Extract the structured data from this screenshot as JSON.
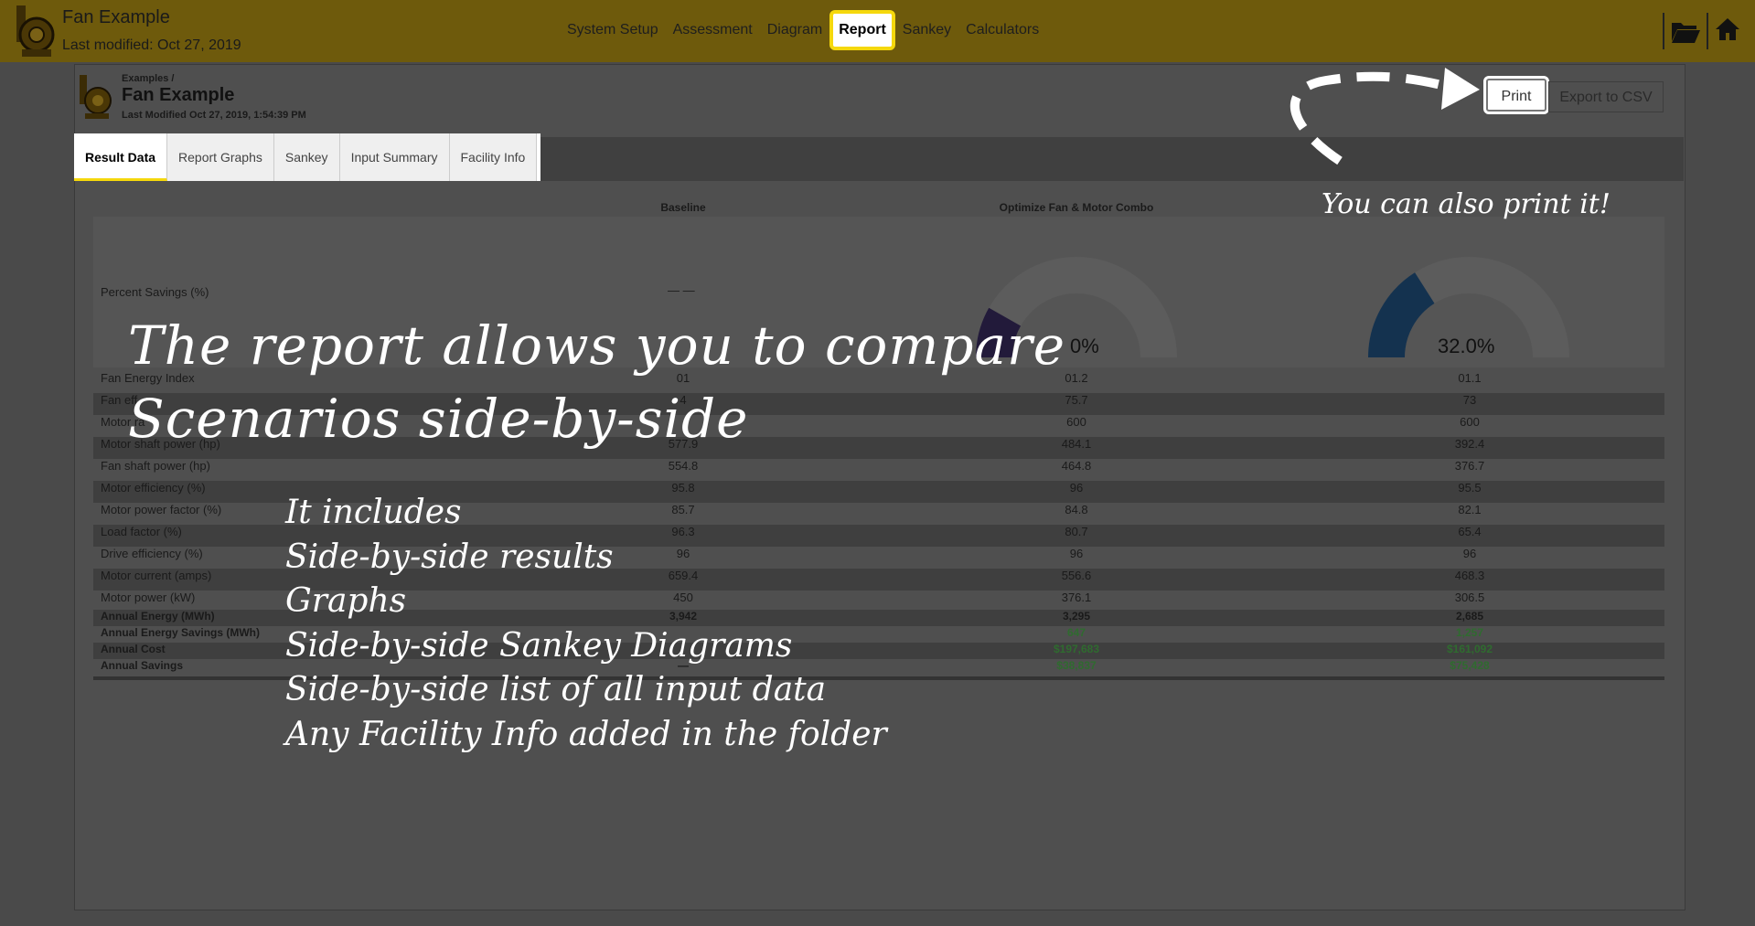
{
  "app": {
    "title": "Fan Example",
    "last_modified": "Last modified: Oct 27, 2019"
  },
  "nav": {
    "items": [
      "System Setup",
      "Assessment",
      "Diagram",
      "Report",
      "Sankey",
      "Calculators"
    ],
    "active": "Report"
  },
  "report_header": {
    "breadcrumb": "Examples /",
    "title": "Fan Example",
    "last_modified": "Last Modified Oct 27, 2019, 1:54:39 PM"
  },
  "buttons": {
    "print": "Print",
    "export_csv": "Export to CSV"
  },
  "tabs": [
    "Result Data",
    "Report Graphs",
    "Sankey",
    "Input Summary",
    "Facility Info"
  ],
  "table": {
    "columns": [
      "Baseline",
      "Optimize Fan & Motor Combo"
    ],
    "percent_savings": {
      "label": "Percent Savings (%)",
      "baseline": "— —",
      "scenario1_visible": "0%",
      "scenario1_fraction": 0.164,
      "scenario2": "32.0%",
      "scenario2_fraction": 0.32
    },
    "rows": [
      {
        "label": "Fan Energy Index",
        "c1": "01",
        "c2": "01.2",
        "c3": "01.1"
      },
      {
        "label": "Fan eff",
        "c1": "4",
        "c2": "75.7",
        "c3": "73"
      },
      {
        "label": "Motor ra",
        "c1": "",
        "c2": "600",
        "c3": "600"
      },
      {
        "label": "Motor shaft power (hp)",
        "c1": "577.9",
        "c2": "484.1",
        "c3": "392.4"
      },
      {
        "label": "Fan shaft power (hp)",
        "c1": "554.8",
        "c2": "464.8",
        "c3": "376.7"
      },
      {
        "label": "Motor efficiency (%)",
        "c1": "95.8",
        "c2": "96",
        "c3": "95.5"
      },
      {
        "label": "Motor power factor (%)",
        "c1": "85.7",
        "c2": "84.8",
        "c3": "82.1"
      },
      {
        "label": "Load factor (%)",
        "c1": "96.3",
        "c2": "80.7",
        "c3": "65.4"
      },
      {
        "label": "Drive efficiency (%)",
        "c1": "96",
        "c2": "96",
        "c3": "96"
      },
      {
        "label": "Motor current (amps)",
        "c1": "659.4",
        "c2": "556.6",
        "c3": "468.3"
      },
      {
        "label": "Motor power (kW)",
        "c1": "450",
        "c2": "376.1",
        "c3": "306.5"
      }
    ],
    "summary_rows": [
      {
        "label": "Annual Energy (MWh)",
        "c1": "3,942",
        "c2": "3,295",
        "c3": "2,685"
      },
      {
        "label": "Annual Energy Savings (MWh)",
        "c1": "",
        "c2": "647",
        "c3": "1,257"
      },
      {
        "label": "Annual Cost",
        "c1": "",
        "c2": "$197,683",
        "c3": "$161,092"
      },
      {
        "label": "Annual Savings",
        "c1": "—",
        "c2": "$38,837",
        "c3": "$75,428"
      }
    ]
  },
  "annotations": {
    "main_line1": "The report allows you to compare",
    "main_line2": "Scenarios side-by-side",
    "list": [
      "It includes",
      "Side-by-side results",
      "Graphs",
      "Side-by-side Sankey Diagrams",
      "Side-by-side list of all input data",
      "Any Facility Info added in the folder"
    ],
    "print_note": "You can also print it!"
  },
  "colors": {
    "topbar": "#6e5a0c",
    "highlight": "#f5d80c",
    "gauge_track": "#5c5c5c",
    "gauge_fill_1": "#221a3a",
    "gauge_fill_2": "#14324f",
    "savings_green": "#2f6b2f"
  }
}
